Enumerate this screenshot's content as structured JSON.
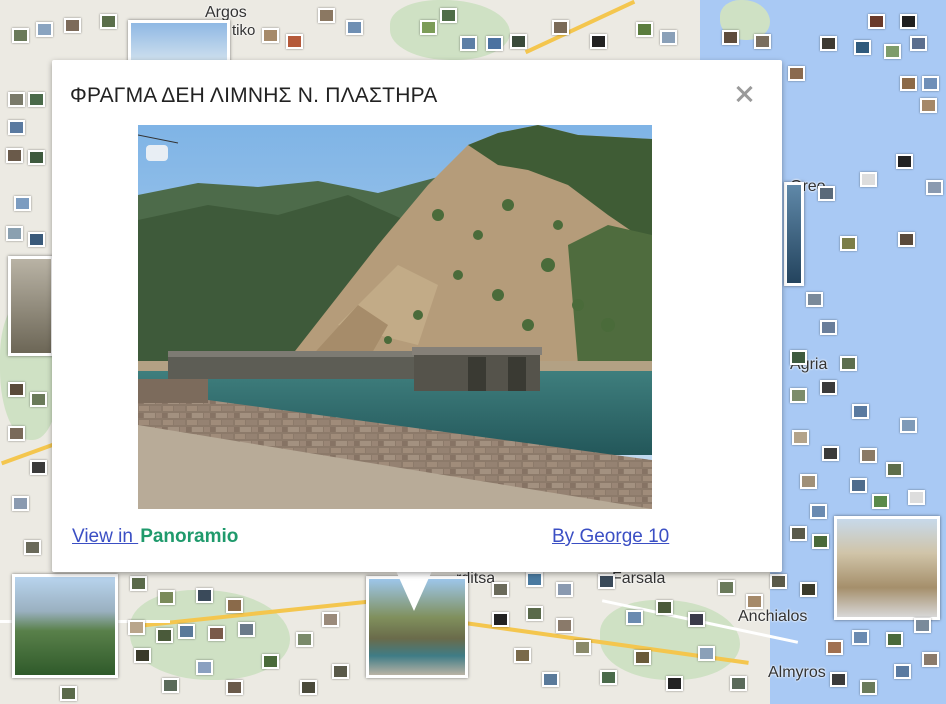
{
  "map": {
    "labels": {
      "top": "Argos",
      "top2": "tiko",
      "oreo": "Oreo",
      "aglia": "Agria",
      "farsala": "Farsala",
      "ardtsa": "rditsa",
      "anchialos": "Anchialos",
      "almyros": "Almyros"
    }
  },
  "info_window": {
    "title": "ΦΡΑΓΜΑ ΔΕΗ ΛΙΜΝΗΣ Ν. ΠΛΑΣΤΗΡΑ",
    "view_prefix": "View in ",
    "brand": "Panoramio",
    "author_link": "By George 10",
    "close_icon": "close-icon"
  },
  "colors": {
    "link": "#3b4fc4",
    "brand": "#1f9a6c",
    "sea": "#a9c9f4"
  }
}
